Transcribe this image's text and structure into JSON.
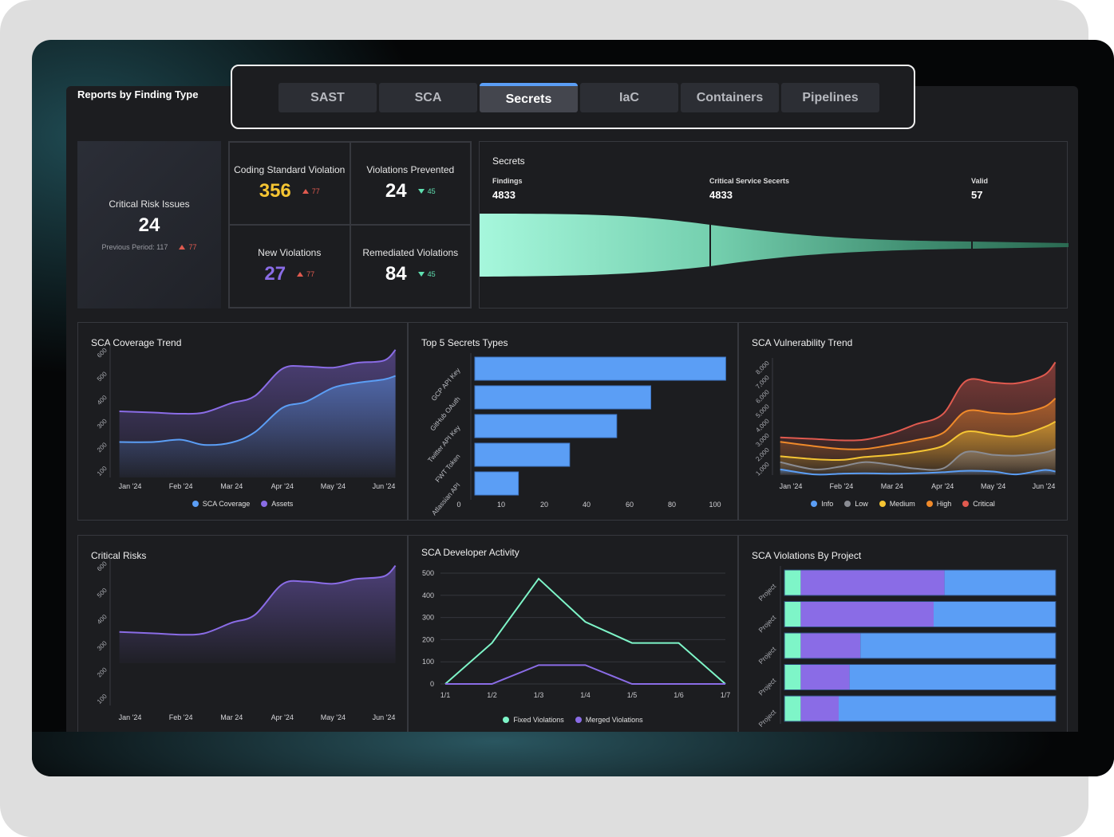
{
  "header": {
    "title": "Reports by Finding Type"
  },
  "tabs": [
    {
      "label": "SAST"
    },
    {
      "label": "SCA"
    },
    {
      "label": "Secrets",
      "active": true
    },
    {
      "label": "IaC"
    },
    {
      "label": "Containers"
    },
    {
      "label": "Pipelines"
    }
  ],
  "critical_risk": {
    "label": "Critical Risk Issues",
    "value": "24",
    "previous": "Previous Period: 117",
    "delta": "77",
    "delta_dir": "up"
  },
  "metrics": [
    {
      "label": "Coding Standard Violation",
      "value": "356",
      "delta": "77",
      "delta_dir": "up",
      "color": "#f5c533"
    },
    {
      "label": "Violations Prevented",
      "value": "24",
      "delta": "45",
      "delta_dir": "down",
      "color": "#ffffff"
    },
    {
      "label": "New Violations",
      "value": "27",
      "delta": "77",
      "delta_dir": "up",
      "color": "#8a6ce6"
    },
    {
      "label": "Remediated Violations",
      "value": "84",
      "delta": "45",
      "delta_dir": "down",
      "color": "#ffffff"
    }
  ],
  "secrets_funnel": {
    "title": "Secrets",
    "stages": [
      {
        "label": "Findings",
        "value": "4833"
      },
      {
        "label": "Critical Service Secerts",
        "value": "4833"
      },
      {
        "label": "Valid",
        "value": "57"
      }
    ]
  },
  "colors": {
    "blue": "#5b9ef5",
    "purple": "#8a6ce6",
    "green": "#7ef5c8",
    "info": "#5b9ef5",
    "low": "#8a8c93",
    "medium": "#f5c533",
    "high": "#f08a2a",
    "critical": "#e05a4f",
    "up": "#e05a4f",
    "down": "#5fe0b0"
  },
  "chart_data": [
    {
      "id": "coverage",
      "type": "area",
      "title": "SCA Coverage Trend",
      "ylim": [
        70,
        630
      ],
      "yticks": [
        "100",
        "200",
        "300",
        "400",
        "500",
        "600"
      ],
      "xticks": [
        {
          "label": "Jan '24",
          "date": "2024-01-01"
        },
        {
          "label": "Feb '24",
          "date": "2024-02-01"
        },
        {
          "label": "Mar 24",
          "date": "2024-03-01"
        },
        {
          "label": "Apr '24",
          "date": "2024-04-01"
        },
        {
          "label": "May '24",
          "date": "2024-05-01"
        },
        {
          "label": "Jun '24",
          "date": "2024-06-01"
        }
      ],
      "x": [
        "2023-12-25",
        "2024-01-15",
        "2024-02-01",
        "2024-02-15",
        "2024-03-01",
        "2024-03-15",
        "2024-04-01",
        "2024-04-15",
        "2024-05-01",
        "2024-05-15",
        "2024-06-01",
        "2024-06-08"
      ],
      "series": [
        {
          "name": "Assets",
          "color": "#8a6ce6",
          "values": [
            350,
            345,
            340,
            345,
            385,
            415,
            530,
            540,
            535,
            555,
            565,
            610
          ]
        },
        {
          "name": "SCA Coverage",
          "color": "#5b9ef5",
          "values": [
            220,
            220,
            230,
            208,
            218,
            262,
            365,
            390,
            450,
            470,
            485,
            500
          ]
        }
      ],
      "legend": "bottom"
    },
    {
      "id": "top5",
      "type": "bar",
      "orientation": "horizontal",
      "title": "Top 5 Secrets Types",
      "categories": [
        "GCP API Key",
        "GitHub OAuth",
        "Twitter API Key",
        "FWT Token",
        "Atlassian API"
      ],
      "values": [
        105,
        70,
        54,
        32,
        14
      ],
      "xticks": [
        "0",
        "10",
        "20",
        "40",
        "60",
        "80",
        "100"
      ],
      "color": "#5b9ef5"
    },
    {
      "id": "vuln",
      "type": "area",
      "stacked": true,
      "title": "SCA Vulnerability Trend",
      "ylim": [
        400,
        8500
      ],
      "yticks": [
        "1,000",
        "2,000",
        "3,000",
        "4,000",
        "5,000",
        "6,000",
        "7,000",
        "8,000"
      ],
      "xticks": [
        {
          "label": "Jan '24",
          "date": "2024-01-01"
        },
        {
          "label": "Feb '24",
          "date": "2024-02-01"
        },
        {
          "label": "Mar 24",
          "date": "2024-03-01"
        },
        {
          "label": "Apr '24",
          "date": "2024-04-01"
        },
        {
          "label": "May '24",
          "date": "2024-05-01"
        },
        {
          "label": "Jun '24",
          "date": "2024-06-01"
        }
      ],
      "x": [
        "2023-12-25",
        "2024-01-15",
        "2024-02-01",
        "2024-02-15",
        "2024-03-01",
        "2024-03-15",
        "2024-04-01",
        "2024-04-15",
        "2024-05-01",
        "2024-05-15",
        "2024-06-01",
        "2024-06-08"
      ],
      "series": [
        {
          "name": "Critical",
          "color": "#e05a4f",
          "values": [
            3000,
            2900,
            2800,
            2850,
            3300,
            3900,
            4600,
            6900,
            6800,
            6750,
            7300,
            8200
          ]
        },
        {
          "name": "High",
          "color": "#f08a2a",
          "values": [
            2700,
            2400,
            2200,
            2200,
            2500,
            2800,
            3300,
            4800,
            4700,
            4650,
            5100,
            5700
          ]
        },
        {
          "name": "Medium",
          "color": "#f5c533",
          "values": [
            1700,
            1500,
            1450,
            1650,
            1800,
            2000,
            2400,
            3400,
            3200,
            3100,
            3700,
            4100
          ]
        },
        {
          "name": "Low",
          "color": "#8a8c93",
          "values": [
            1300,
            800,
            1000,
            1300,
            1100,
            850,
            850,
            2000,
            1800,
            1750,
            1950,
            2200
          ]
        },
        {
          "name": "Info",
          "color": "#5b9ef5",
          "values": [
            800,
            450,
            500,
            520,
            500,
            520,
            600,
            700,
            650,
            450,
            750,
            650
          ]
        }
      ],
      "legend_order": [
        "Info",
        "Low",
        "Medium",
        "High",
        "Critical"
      ],
      "legend": "bottom"
    },
    {
      "id": "critrisks",
      "type": "area",
      "title": "Critical Risks",
      "ylim": [
        73,
        629
      ],
      "yticks": [
        "100",
        "200",
        "300",
        "400",
        "500",
        "600"
      ],
      "xticks": [
        {
          "label": "Jan '24",
          "date": "2024-01-01"
        },
        {
          "label": "Feb '24",
          "date": "2024-02-01"
        },
        {
          "label": "Mar 24",
          "date": "2024-03-01"
        },
        {
          "label": "Apr '24",
          "date": "2024-04-01"
        },
        {
          "label": "May '24",
          "date": "2024-05-01"
        },
        {
          "label": "Jun '24",
          "date": "2024-06-01"
        }
      ],
      "x": [
        "2023-12-25",
        "2024-01-15",
        "2024-02-01",
        "2024-02-15",
        "2024-03-01",
        "2024-03-15",
        "2024-04-01",
        "2024-04-15",
        "2024-05-01",
        "2024-05-15",
        "2024-06-01",
        "2024-06-08"
      ],
      "series": [
        {
          "color": "#8a6ce6",
          "values": [
            350,
            345,
            340,
            345,
            385,
            415,
            530,
            540,
            532,
            550,
            560,
            600
          ]
        }
      ]
    },
    {
      "id": "devact",
      "type": "line",
      "title": "SCA Developer Activity",
      "ylim": [
        0,
        500
      ],
      "yticks": [
        "0",
        "100",
        "200",
        "300",
        "400",
        "500"
      ],
      "categories": [
        "1/1",
        "1/2",
        "1/3",
        "1/4",
        "1/5",
        "1/6",
        "1/7"
      ],
      "series": [
        {
          "name": "Fixed Violations",
          "color": "#7ef5c8",
          "values": [
            0,
            185,
            475,
            280,
            185,
            185,
            0
          ]
        },
        {
          "name": "Merged Violations",
          "color": "#8a6ce6",
          "values": [
            0,
            0,
            85,
            85,
            0,
            0,
            0
          ]
        }
      ],
      "grid": true,
      "legend": "bottom"
    },
    {
      "id": "byproject",
      "type": "bar",
      "orientation": "horizontal",
      "stacked": true,
      "title": "SCA Violations By Project",
      "categories": [
        "Project",
        "Project",
        "Project",
        "Project",
        "Project"
      ],
      "series": [
        {
          "color": "#7ef5c8",
          "values": [
            6,
            6,
            6,
            6,
            6
          ]
        },
        {
          "color": "#8a6ce6",
          "values": [
            53,
            49,
            22,
            18,
            14
          ]
        },
        {
          "color": "#5b9ef5",
          "values": [
            41,
            45,
            72,
            76,
            80
          ]
        }
      ],
      "unit": "%"
    }
  ]
}
